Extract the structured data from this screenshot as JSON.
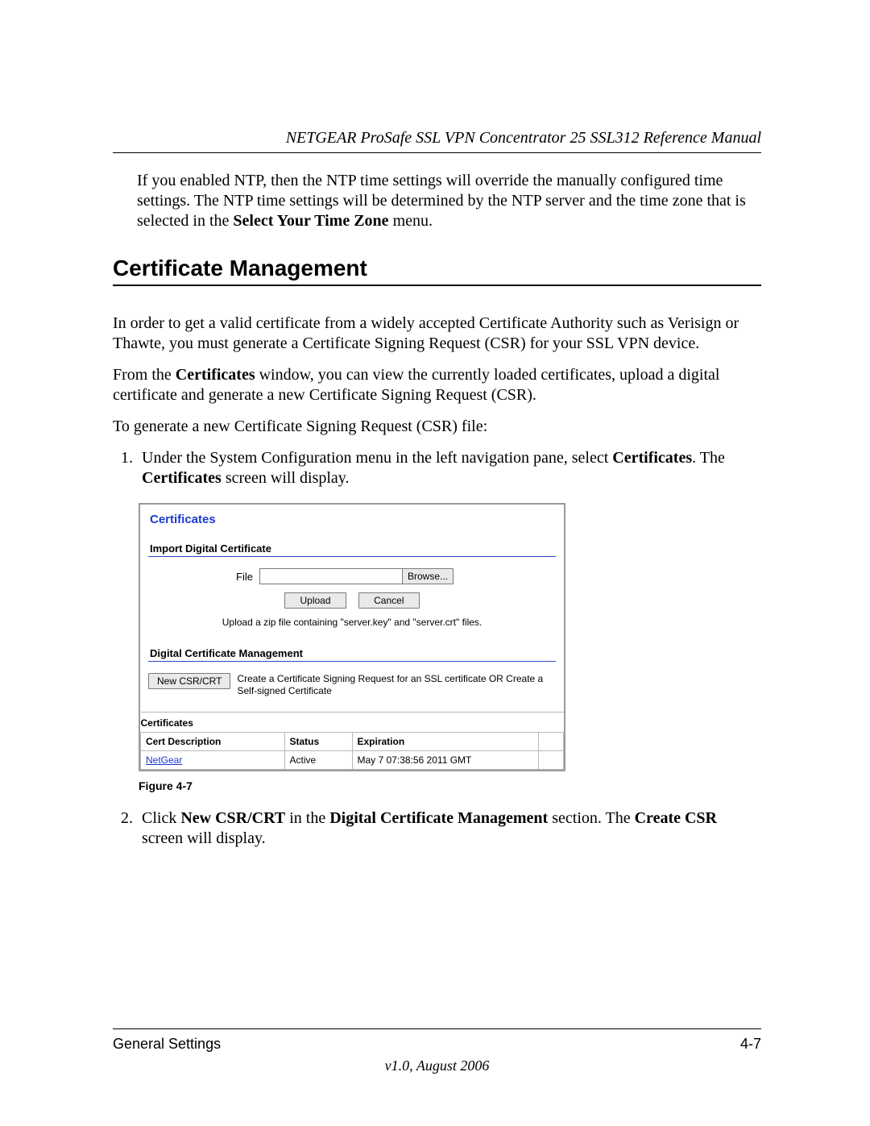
{
  "header": {
    "running_title": "NETGEAR ProSafe SSL VPN Concentrator 25 SSL312 Reference Manual"
  },
  "intro": {
    "p1a": "If you enabled NTP, then the NTP time settings will override the manually configured time settings. The NTP time settings will be determined by the NTP server and the time zone that is selected in the ",
    "bold1": "Select Your Time Zone",
    "p1b": " menu."
  },
  "section_title": "Certificate Management",
  "body": {
    "p1": "In order to get a valid certificate from a widely accepted Certificate Authority such as Verisign or Thawte, you must generate a Certificate Signing Request (CSR) for your SSL VPN device.",
    "p2a": "From the ",
    "p2bold": "Certificates",
    "p2b": " window, you can view the currently loaded certificates, upload a digital certificate and generate a new Certificate Signing Request (CSR).",
    "p3": "To generate a new Certificate Signing Request (CSR) file:"
  },
  "steps": {
    "s1a": "Under the System Configuration menu in the left navigation pane, select ",
    "s1b1": "Certificates",
    "s1c": ". The ",
    "s1b2": "Certificates",
    "s1d": " screen will display.",
    "s2a": "Click ",
    "s2b1": "New CSR/CRT",
    "s2c": " in the ",
    "s2b2": "Digital Certificate Management",
    "s2d": " section. The ",
    "s2b3": "Create CSR",
    "s2e": " screen will display."
  },
  "ui": {
    "title": "Certificates",
    "import_head": "Import Digital Certificate",
    "file_label": "File",
    "browse": "Browse...",
    "upload": "Upload",
    "cancel": "Cancel",
    "helper": "Upload a zip file containing \"server.key\" and \"server.crt\" files.",
    "dcm_head": "Digital Certificate Management",
    "new_csr": "New CSR/CRT",
    "dcm_desc": "Create a Certificate Signing Request for an SSL certificate OR Create a Self-signed Certificate",
    "table_section": "Certificates",
    "th_desc": "Cert Description",
    "th_status": "Status",
    "th_exp": "Expiration",
    "row1_desc": "NetGear",
    "row1_status": "Active",
    "row1_exp": "May 7 07:38:56 2011 GMT"
  },
  "figure_caption": "Figure 4-7",
  "footer": {
    "left": "General Settings",
    "right": "4-7",
    "version": "v1.0, August 2006"
  }
}
